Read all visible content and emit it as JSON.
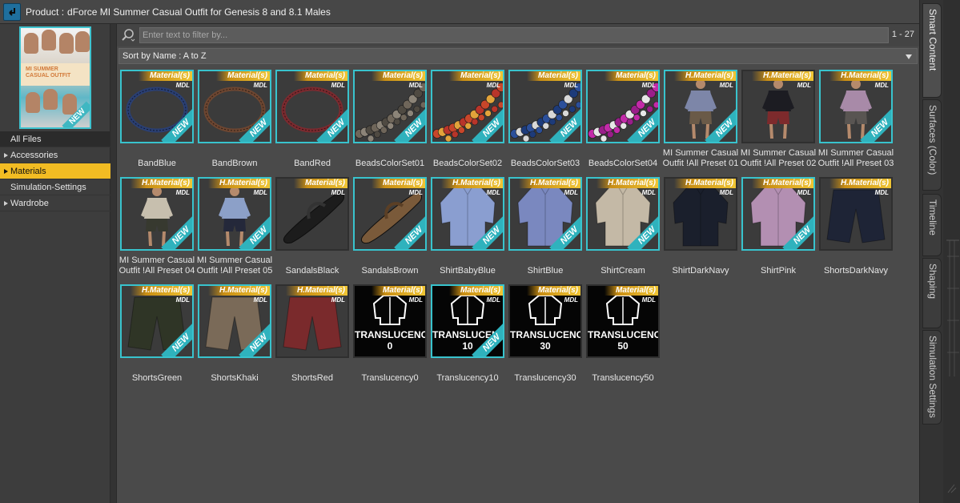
{
  "header": {
    "back_icon": "back-arrow-icon",
    "product_label": "Product :",
    "product_name": "dForce MI Summer Casual Outfit for Genesis 8 and 8.1 Males"
  },
  "thumbnail": {
    "band_text": "MI SUMMER CASUAL OUTFIT",
    "badge": "NEW"
  },
  "folders": [
    {
      "label": "All Files",
      "arrow": false
    },
    {
      "label": "Accessories",
      "arrow": true
    },
    {
      "label": "Materials",
      "arrow": true,
      "selected": true
    },
    {
      "label": "Simulation-Settings",
      "arrow": false
    },
    {
      "label": "Wardrobe",
      "arrow": true
    }
  ],
  "filter": {
    "placeholder": "Enter text to filter by...",
    "count": "1 - 27"
  },
  "sort": {
    "label": "Sort by Name : A to Z"
  },
  "badge_new": "NEW",
  "badge_mdl": "MDL",
  "items": [
    {
      "name": "BandBlue",
      "tag": "Material(s)",
      "kind": "ring",
      "color": "#2a3f73",
      "new": true
    },
    {
      "name": "BandBrown",
      "tag": "Material(s)",
      "kind": "ring",
      "color": "#6d4631",
      "new": true
    },
    {
      "name": "BandRed",
      "tag": "Material(s)",
      "kind": "ring",
      "color": "#7b2a2f",
      "new": true
    },
    {
      "name": "BeadsColorSet01",
      "tag": "Material(s)",
      "kind": "beads",
      "colors": [
        "#6f665a",
        "#8c8478",
        "#4f4a42"
      ],
      "new": true
    },
    {
      "name": "BeadsColorSet02",
      "tag": "Material(s)",
      "kind": "beads",
      "colors": [
        "#c8462a",
        "#e2a33a",
        "#b8352a"
      ],
      "new": true
    },
    {
      "name": "BeadsColorSet03",
      "tag": "Material(s)",
      "kind": "beads",
      "colors": [
        "#2b4f9a",
        "#d8d8d8",
        "#1d3b7a"
      ],
      "new": true
    },
    {
      "name": "BeadsColorSet04",
      "tag": "Material(s)",
      "kind": "beads",
      "colors": [
        "#c22aa8",
        "#e7e7e7",
        "#9a1e8a"
      ],
      "new": true
    },
    {
      "name": "MI Summer Casual Outfit !All Preset 01",
      "tag": "H.Material(s)",
      "kind": "figure",
      "shirt": "#7d86a8",
      "shorts": "#6a5a48",
      "new": true
    },
    {
      "name": "MI Summer Casual Outfit !All Preset 02",
      "tag": "H.Material(s)",
      "kind": "figure",
      "shirt": "#1c1c22",
      "shorts": "#7d2a2c",
      "new": false
    },
    {
      "name": "MI Summer Casual Outfit !All Preset 03",
      "tag": "H.Material(s)",
      "kind": "figure",
      "shirt": "#a88aa8",
      "shorts": "#595552",
      "new": true
    },
    {
      "name": "MI Summer Casual Outfit !All Preset 04",
      "tag": "H.Material(s)",
      "kind": "figure",
      "shirt": "#c7bfae",
      "shorts": "#37392f",
      "new": true
    },
    {
      "name": "MI Summer Casual Outfit !All Preset 05",
      "tag": "H.Material(s)",
      "kind": "figure",
      "shirt": "#8ca0c8",
      "shorts": "#24283a",
      "new": true
    },
    {
      "name": "SandalsBlack",
      "tag": "Material(s)",
      "kind": "sandal",
      "color": "#1c1c1c",
      "new": false
    },
    {
      "name": "SandalsBrown",
      "tag": "Material(s)",
      "kind": "sandal",
      "color": "#7a5a3a",
      "new": true
    },
    {
      "name": "ShirtBabyBlue",
      "tag": "H.Material(s)",
      "kind": "shirt",
      "color": "#8a9ed0",
      "new": true
    },
    {
      "name": "ShirtBlue",
      "tag": "H.Material(s)",
      "kind": "shirt",
      "color": "#7a88bf",
      "new": true
    },
    {
      "name": "ShirtCream",
      "tag": "H.Material(s)",
      "kind": "shirt",
      "color": "#c4b9a6",
      "new": true
    },
    {
      "name": "ShirtDarkNavy",
      "tag": "H.Material(s)",
      "kind": "shirt",
      "color": "#1a1f2c",
      "new": false
    },
    {
      "name": "ShirtPink",
      "tag": "H.Material(s)",
      "kind": "shirt",
      "color": "#b38fb2",
      "new": true
    },
    {
      "name": "ShortsDarkNavy",
      "tag": "H.Material(s)",
      "kind": "shorts",
      "color": "#1e2436",
      "new": false
    },
    {
      "name": "ShortsGreen",
      "tag": "H.Material(s)",
      "kind": "shorts",
      "color": "#2f3526",
      "new": true
    },
    {
      "name": "ShortsKhaki",
      "tag": "H.Material(s)",
      "kind": "shorts",
      "color": "#7a6a58",
      "new": true
    },
    {
      "name": "ShortsRed",
      "tag": "H.Material(s)",
      "kind": "shorts",
      "color": "#7a2a2c",
      "new": false
    },
    {
      "name": "Translucency0",
      "tag": "Material(s)",
      "kind": "trans",
      "t1": "TRANSLUCENCY",
      "t2": "0",
      "new": false
    },
    {
      "name": "Translucency10",
      "tag": "Material(s)",
      "kind": "trans",
      "t1": "TRANSLUCENCY",
      "t2": "10",
      "new": true
    },
    {
      "name": "Translucency30",
      "tag": "Material(s)",
      "kind": "trans",
      "t1": "TRANSLUCENCY",
      "t2": "30",
      "new": false
    },
    {
      "name": "Translucency50",
      "tag": "Material(s)",
      "kind": "trans",
      "t1": "TRANSLUCENCY",
      "t2": "50",
      "new": false
    }
  ],
  "right_tabs": [
    "Smart Content",
    "Surfaces (Color)",
    "Timeline",
    "Shaping",
    "Simulation Settings"
  ],
  "colors": {
    "accent_teal": "#38c3cd",
    "selection_gold": "#f2bc23",
    "back_button": "#1f6f9e"
  }
}
